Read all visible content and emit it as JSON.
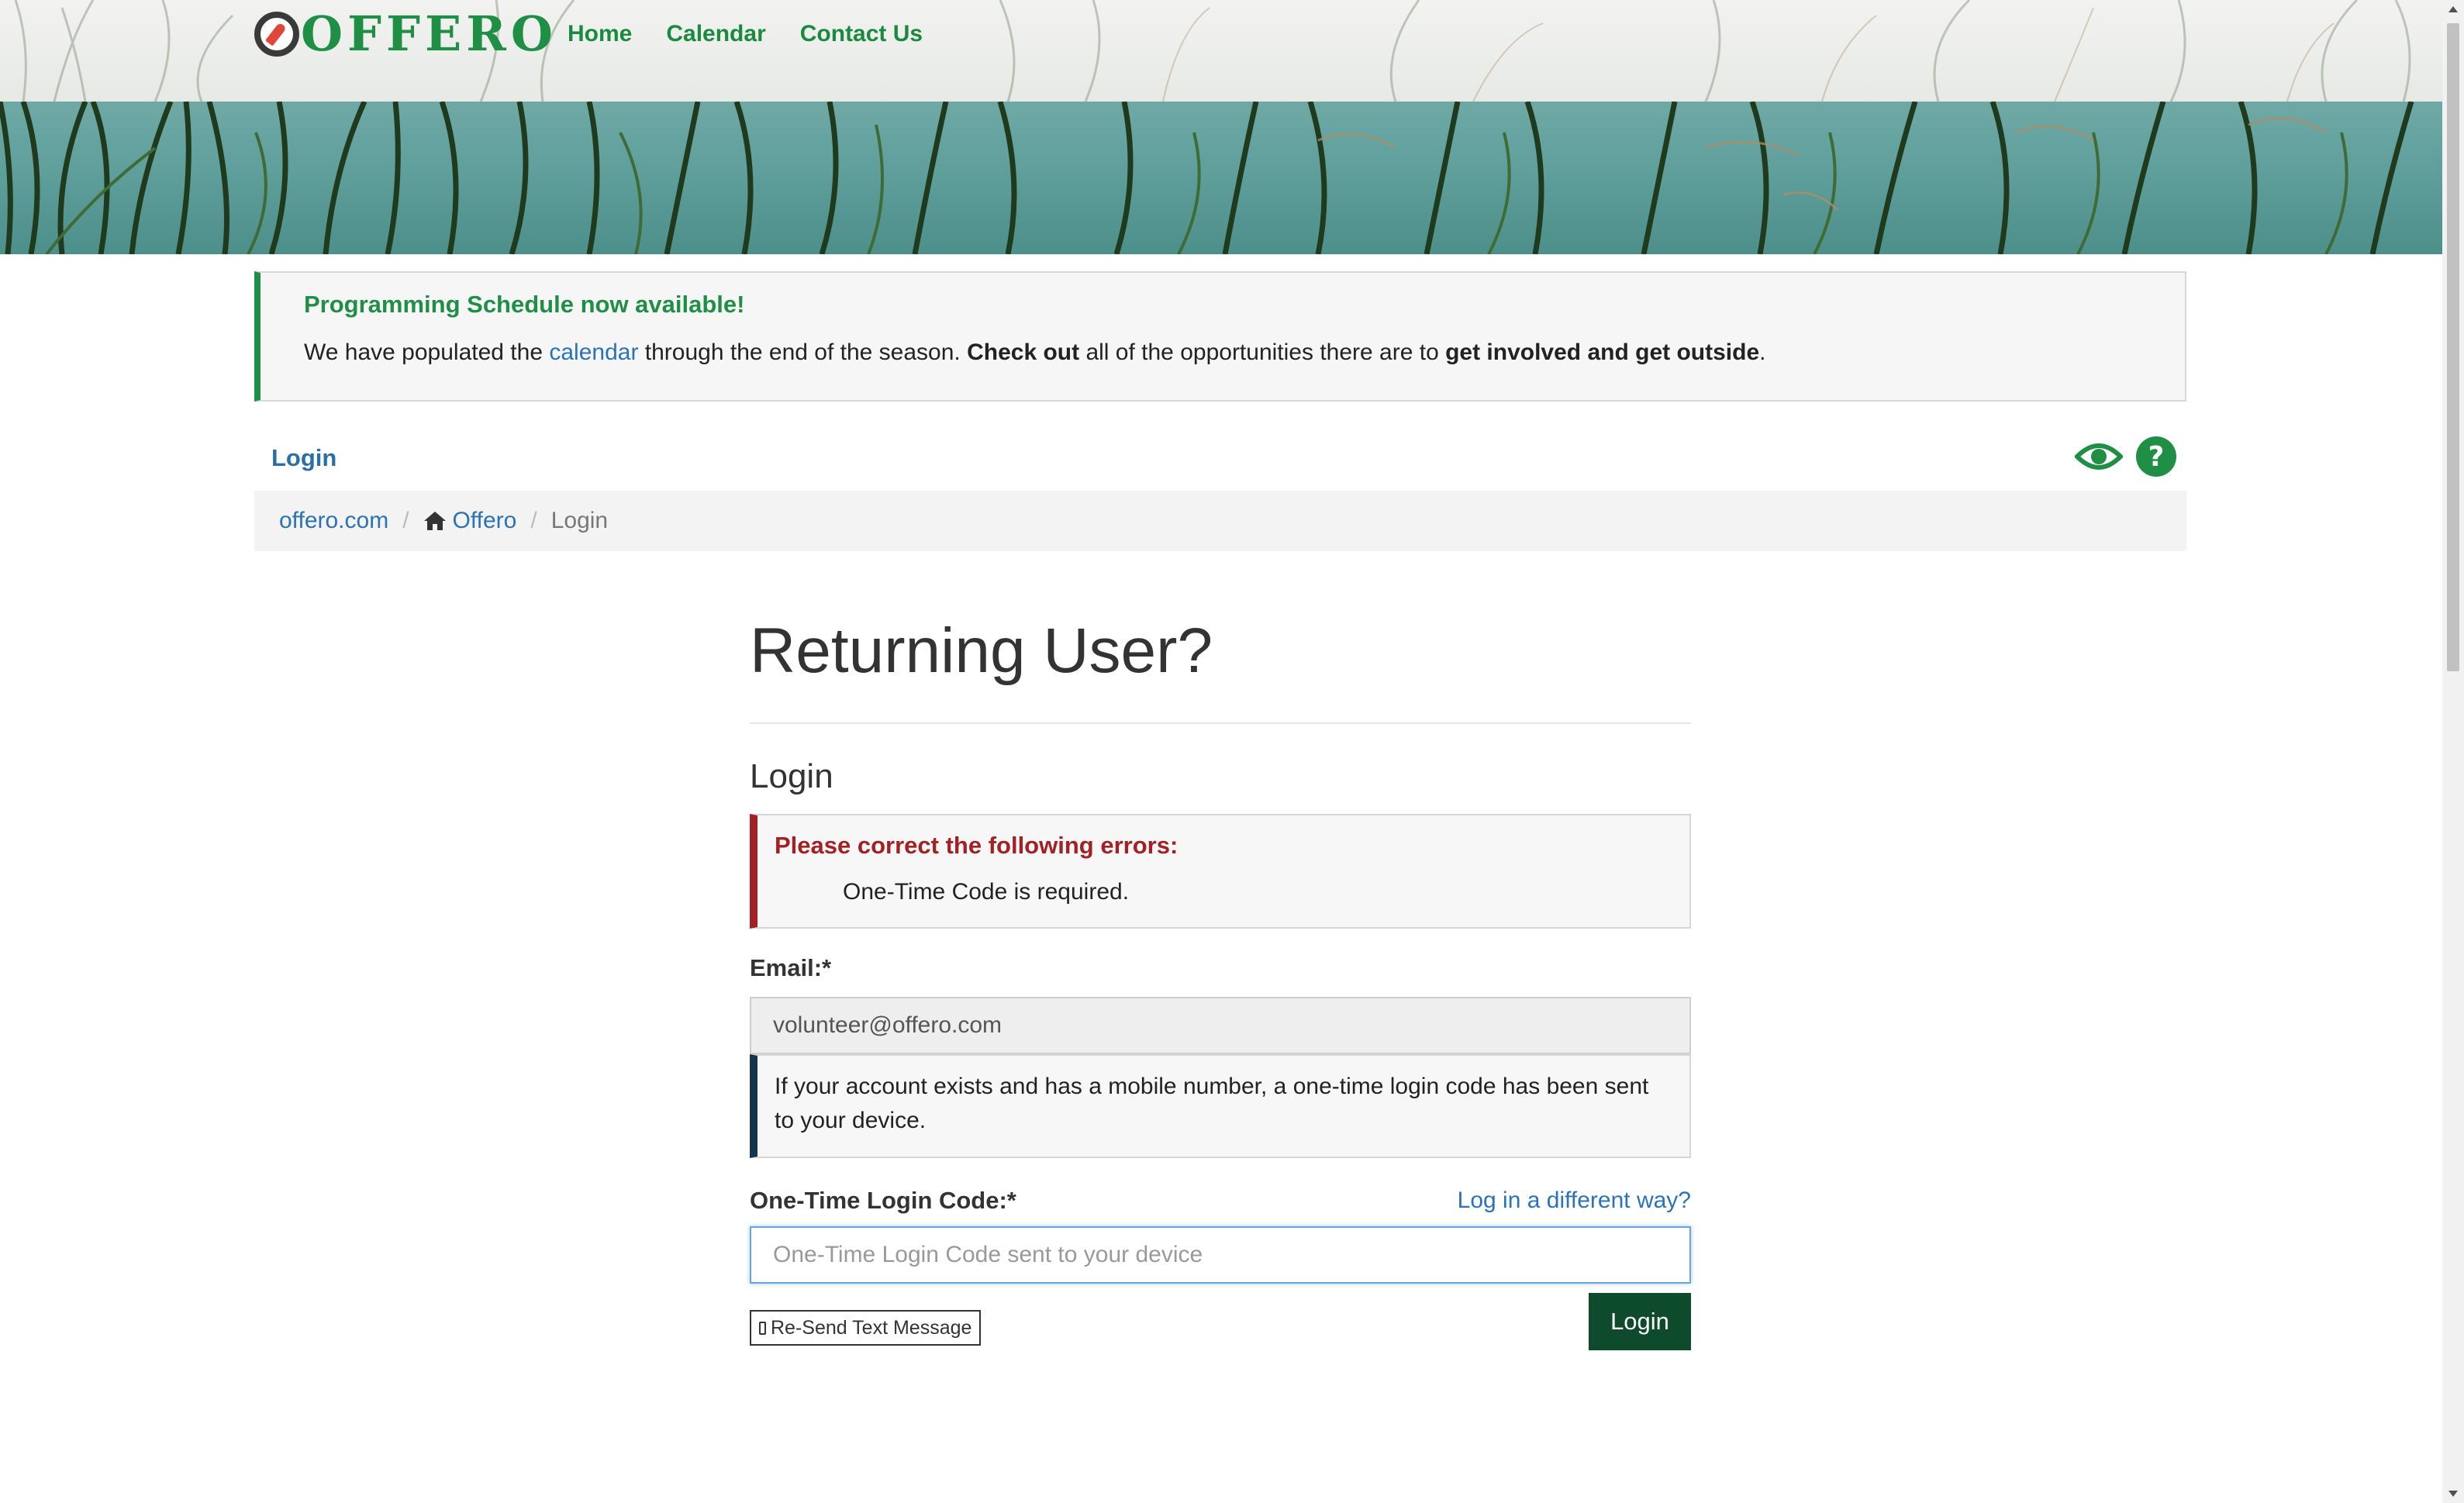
{
  "brand": {
    "name": "OFFERO"
  },
  "nav": {
    "items": [
      {
        "label": "Home"
      },
      {
        "label": "Calendar"
      },
      {
        "label": "Contact Us"
      }
    ]
  },
  "announcement": {
    "title": "Programming Schedule now available!",
    "text_1": "We have populated the ",
    "link": "calendar",
    "text_2": " through the end of the season. ",
    "bold_1": "Check out",
    "text_3": " all of the opportunities there are to ",
    "bold_2": "get involved and get outside",
    "text_4": "."
  },
  "page": {
    "label": "Login"
  },
  "breadcrumb": {
    "items": [
      {
        "label": "offero.com"
      },
      {
        "label": "Offero"
      },
      {
        "label": "Login"
      }
    ]
  },
  "form": {
    "heading": "Returning User?",
    "subheading": "Login",
    "errors": {
      "title": "Please correct the following errors:",
      "items": [
        "One-Time Code is required."
      ]
    },
    "email": {
      "label": "Email:*",
      "value": "volunteer@offero.com"
    },
    "info": "If your account exists and has a mobile number, a one-time login code has been sent to your device.",
    "code": {
      "label": "One-Time Login Code:*",
      "placeholder": "One-Time Login Code sent to your device",
      "alt_link": "Log in a different way?"
    },
    "resend_label": "Re-Send Text Message",
    "submit_label": "Login"
  },
  "colors": {
    "brand_green": "#1f8f45",
    "error_red": "#a32124",
    "info_navy": "#17344f",
    "button_dark_green": "#0e4a2c",
    "link_blue": "#2a73b8"
  }
}
